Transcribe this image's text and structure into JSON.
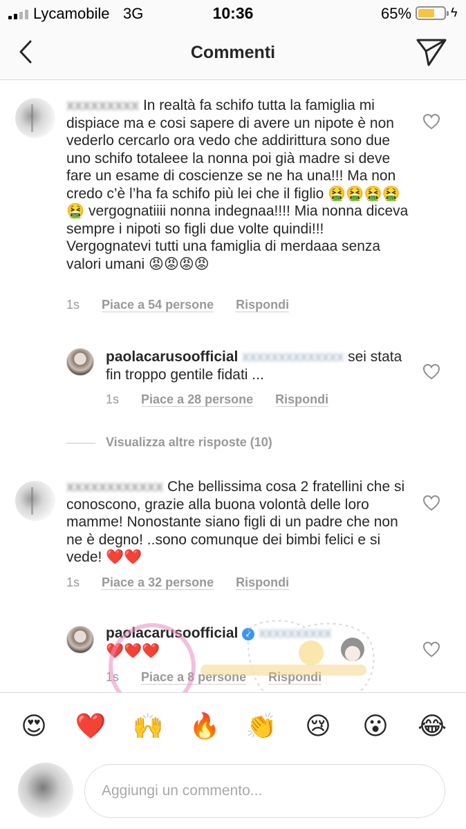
{
  "status_bar": {
    "carrier": "Lycamobile",
    "network": "3G",
    "time": "10:36",
    "battery_percent": "65%",
    "battery_level": 0.65
  },
  "nav": {
    "title": "Commenti",
    "back_icon": "chevron-left-icon",
    "send_icon": "direct-send-icon"
  },
  "comments": [
    {
      "text": " In realtà fa schifo tutta la famiglia mi dispiace ma e cosi sapere di avere un nipote è non vederlo cercarlo ora vedo che addirittura sono due uno schifo totaleee la nonna poi già madre si deve fare un esame di coscienze se ne ha una!!! Ma non credo c’è l’ha fa schifo più lei che il figlio 🤮🤮🤮🤮🤮 vergognatiiii nonna indegnaa!!!! Mia nonna diceva sempre i nipoti so figli due volte quindi!!! Vergognatevi tutti una famiglia di merdaaa senza valori umani 😡😡😡😡",
      "time": "1s",
      "likes": "Piace a 54 persone",
      "reply": "Rispondi"
    },
    {
      "username": "paolacarusoofficial",
      "text": " sei stata fin troppo gentile fidati ...",
      "time": "1s",
      "likes": "Piace a 28 persone",
      "reply": "Rispondi"
    },
    {
      "text": " Che bellissima cosa 2 fratellini che si conoscono, grazie alla buona volontà delle loro mamme! Nonostante siano figli di un padre che non ne è degno! ..sono comunque dei bimbi felici e si vede! ❤️❤️",
      "time": "1s",
      "likes": "Piace a 32 persone",
      "reply": "Rispondi"
    },
    {
      "username": "paolacarusoofficial",
      "text": "❤️❤️❤️",
      "time": "1s",
      "likes": "Piace a 8 persone",
      "reply": "Rispondi"
    }
  ],
  "more_replies": "Visualizza altre risposte (10)",
  "emoji_bar": [
    "😍",
    "❤️",
    "🙌",
    "🔥",
    "👏",
    "😢",
    "😮",
    "😂"
  ],
  "composer": {
    "placeholder": "Aggiungi un commento..."
  },
  "colors": {
    "text": "#262626",
    "secondary": "#999999",
    "verified": "#3897f0",
    "battery": "#f5c542"
  }
}
